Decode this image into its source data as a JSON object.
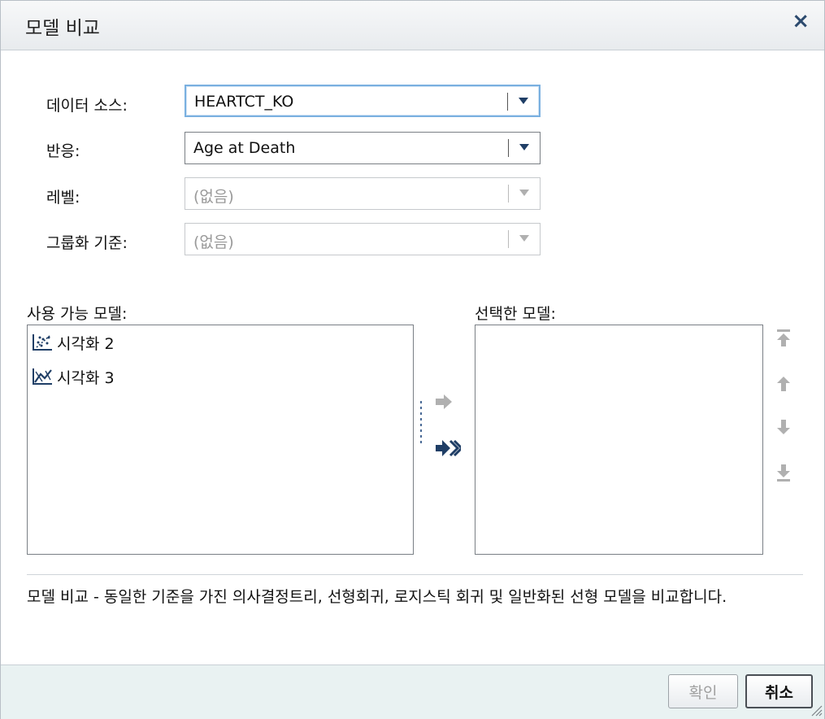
{
  "dialog": {
    "title": "모델 비교",
    "close_glyph": "×"
  },
  "form": {
    "data_source": {
      "label": "데이터 소스:",
      "value": "HEARTCT_KO"
    },
    "response": {
      "label": "반응:",
      "value": "Age at Death"
    },
    "level": {
      "label": "레벨:",
      "value": "(없음)"
    },
    "group_by": {
      "label": "그룹화 기준:",
      "value": "(없음)"
    }
  },
  "available_models": {
    "label": "사용 가능 모델:",
    "items": [
      {
        "label": "시각화 2",
        "icon": "scatter-plot-icon"
      },
      {
        "label": "시각화 3",
        "icon": "line-fit-plot-icon"
      }
    ]
  },
  "selected_models": {
    "label": "선택한 모델:",
    "items": []
  },
  "description": "모델 비교 - 동일한 기준을 가진 의사결정트리, 선형회귀, 로지스틱 회귀  및 일반화된 선형 모델을 비교합니다.",
  "buttons": {
    "ok": "확인",
    "cancel": "취소"
  },
  "colors": {
    "accent": "#1f3e66",
    "disabled": "#b0b0b0",
    "footer_bg": "#e9f2f2"
  }
}
